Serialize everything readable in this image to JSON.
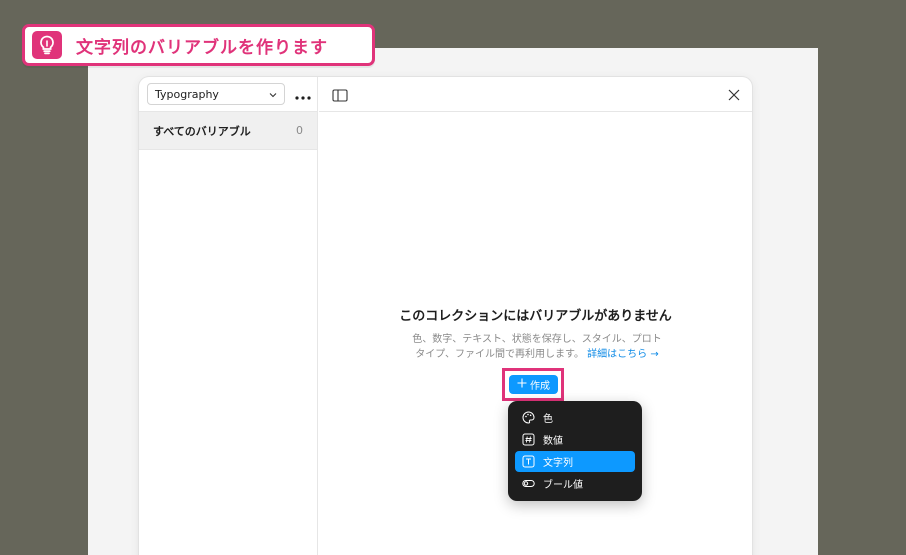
{
  "callout": {
    "text": "文字列のバリアブルを作ります"
  },
  "sidebar": {
    "collection_name": "Typography",
    "all_variables_label": "すべてのバリアブル",
    "all_variables_count": "0"
  },
  "empty_state": {
    "title": "このコレクションにはバリアブルがありません",
    "desc_line1": "色、数字、テキスト、状態を保存し、スタイル、プロト",
    "desc_line2": "タイプ、ファイル間で再利用します。",
    "learn_more": "詳細はこちら →",
    "create_label": "作成"
  },
  "menu": {
    "items": [
      {
        "label": "色",
        "icon": "palette-icon"
      },
      {
        "label": "数値",
        "icon": "hash-icon"
      },
      {
        "label": "文字列",
        "icon": "text-icon"
      },
      {
        "label": "ブール値",
        "icon": "toggle-icon"
      }
    ],
    "active_index": 2
  },
  "colors": {
    "accent": "#0d99ff",
    "highlight": "#e0337a",
    "menu_bg": "#1e1e1e",
    "background": "#66665a"
  }
}
